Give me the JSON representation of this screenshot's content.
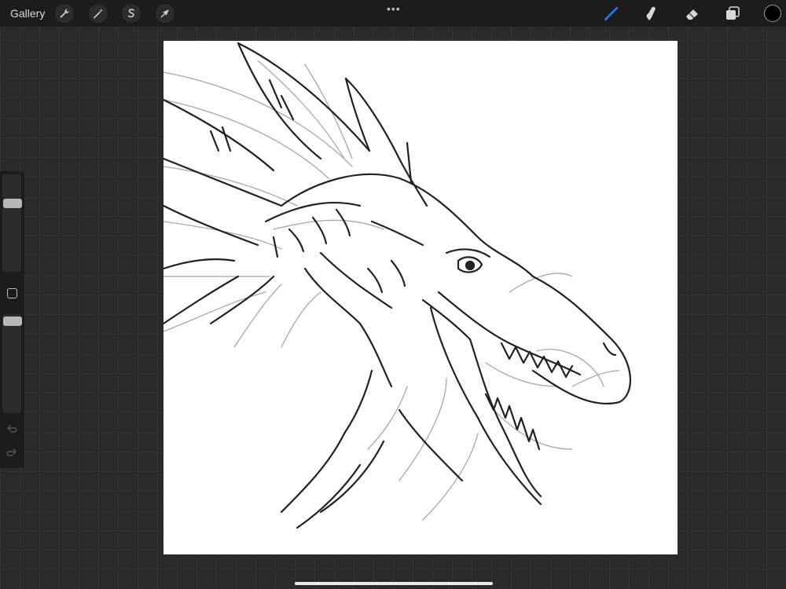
{
  "toolbar": {
    "gallery_label": "Gallery",
    "left_tools": [
      "wrench-icon",
      "magic-wand-icon",
      "selection-s-icon",
      "transform-arrow-icon"
    ],
    "more_label": "•••",
    "right_tools": [
      "brush-icon",
      "smudge-icon",
      "eraser-icon",
      "layers-icon"
    ],
    "active_tool": "brush",
    "active_color": "#1e7ef5",
    "current_color": "#000000"
  },
  "sidebar": {
    "brush_size": 0.72,
    "opacity": 0.97,
    "modify_icon": "square-icon",
    "undo_icon": "undo-arrow-icon",
    "redo_icon": "redo-arrow-icon"
  },
  "canvas": {
    "subject": "dragon-head-line-sketch",
    "background": "#ffffff",
    "stroke_color": "#222222",
    "sketch_color": "#9a9a9a"
  }
}
